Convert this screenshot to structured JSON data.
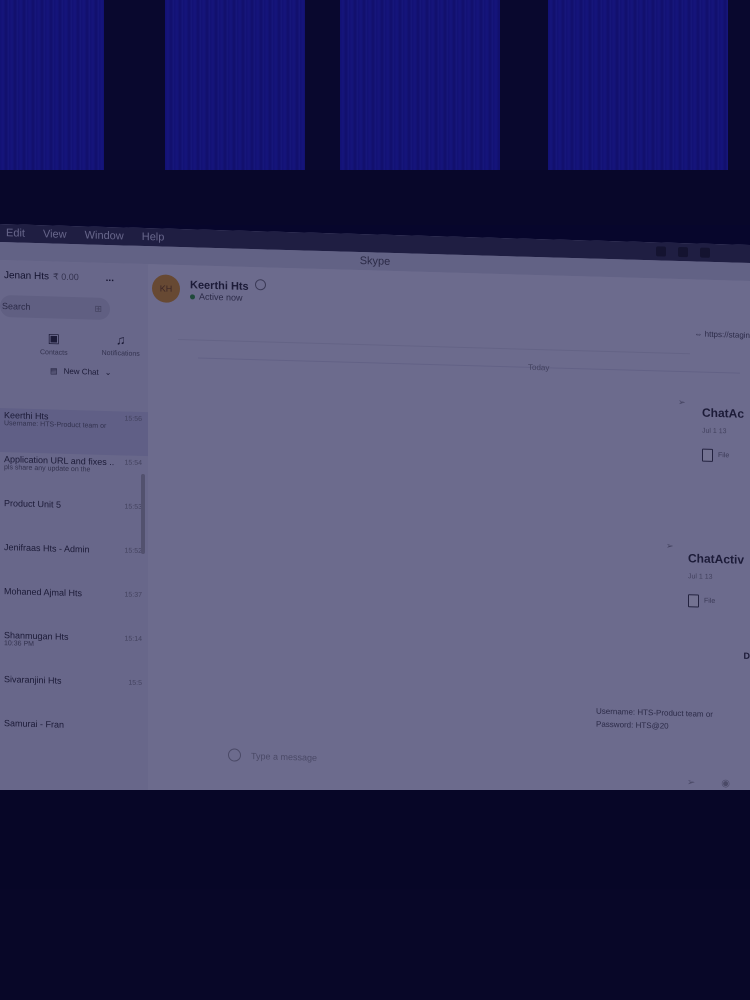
{
  "menubar": {
    "items": [
      "Edit",
      "View",
      "Window",
      "Help"
    ]
  },
  "window": {
    "title": "Skype"
  },
  "sidebar": {
    "profile_name": "Jenan Hts",
    "profile_amount": "₹ 0.00",
    "more_label": "...",
    "search_placeholder": "Search",
    "nav": [
      {
        "icon": "contacts-icon",
        "label": "Contacts"
      },
      {
        "icon": "bell-icon",
        "label": "Notifications"
      }
    ],
    "new_chat_label": "New Chat",
    "chats": [
      {
        "name": "Keerthi Hts",
        "preview": "Username: HTS-Product team or",
        "time": "15:56",
        "active": true
      },
      {
        "name": "Application URL and fixes ...",
        "preview": "pls share any update on the",
        "time": "15:54",
        "active": false
      },
      {
        "name": "Product Unit 5",
        "preview": "",
        "time": "15:53",
        "active": false
      },
      {
        "name": "Jenifraas Hts - Admin",
        "preview": "",
        "time": "15:52",
        "active": false
      },
      {
        "name": "Mohaned Ajmal Hts",
        "preview": "",
        "time": "15:37",
        "active": false
      },
      {
        "name": "Shanmugan Hts",
        "preview": "10:36 PM",
        "time": "15:14",
        "active": false
      },
      {
        "name": "Sivaranjini Hts",
        "preview": "",
        "time": "15:5",
        "active": false
      },
      {
        "name": "Samurai - Fran",
        "preview": "",
        "time": "",
        "active": false
      }
    ]
  },
  "chat": {
    "avatar_initials": "KH",
    "contact_name": "Keerthi Hts",
    "status": "Active now",
    "link_text": "https://stagin",
    "date_divider": "Today",
    "messages": [
      {
        "title": "ChatAc",
        "date": "Jul 1 13",
        "file_label": "File"
      },
      {
        "title": "ChatActiv",
        "date": "Jul 1 13",
        "file_label": "File"
      }
    ],
    "msg_fragment": "D",
    "credentials_line1": "Username: HTS-Product team or",
    "credentials_line2": "Password: HTS@20",
    "composer_placeholder": "Type a message"
  },
  "colors": {
    "accent_avatar": "#d99a28",
    "status_online": "#3a9a3a",
    "window_glass": "#2626c8"
  }
}
